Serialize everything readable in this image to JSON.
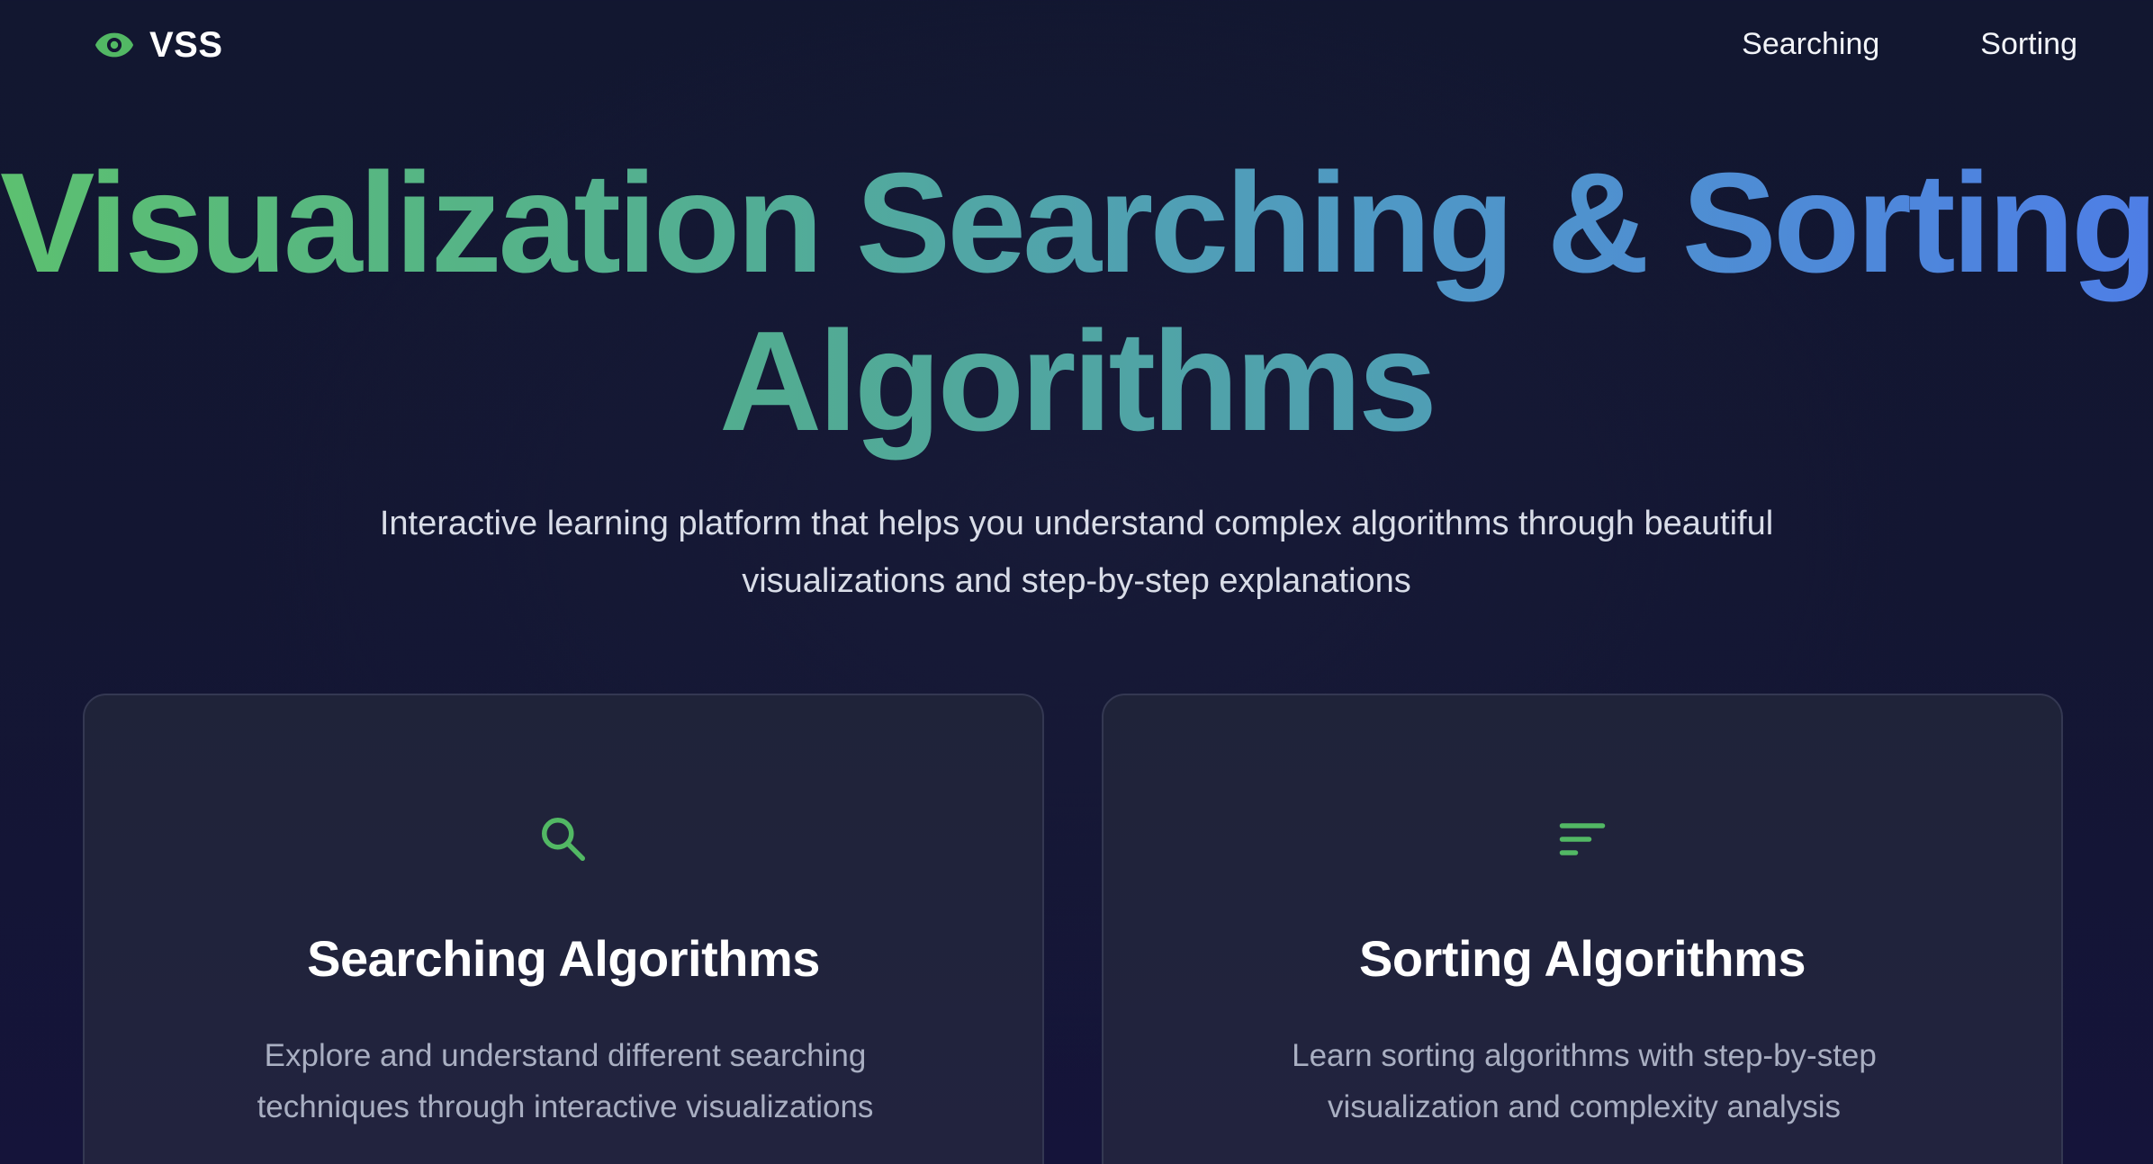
{
  "colors": {
    "accent_green": "#5cc070",
    "accent_blue": "#4e7ee6",
    "background": "#131632",
    "card_background": "#20233d"
  },
  "navbar": {
    "logo_icon": "eye-icon",
    "logo_text": "VSS",
    "links": [
      {
        "label": "Searching"
      },
      {
        "label": "Sorting"
      }
    ]
  },
  "hero": {
    "title_line1": "Visualization Searching & Sorting",
    "title_line2": "Algorithms",
    "subtitle": "Interactive learning platform that helps you understand complex algorithms through beautiful visualizations and step-by-step explanations"
  },
  "cards": [
    {
      "icon": "search-icon",
      "title": "Searching Algorithms",
      "description": "Explore and understand different searching techniques through interactive visualizations"
    },
    {
      "icon": "sort-icon",
      "title": "Sorting Algorithms",
      "description": "Learn sorting algorithms with step-by-step visualization and complexity analysis"
    }
  ]
}
